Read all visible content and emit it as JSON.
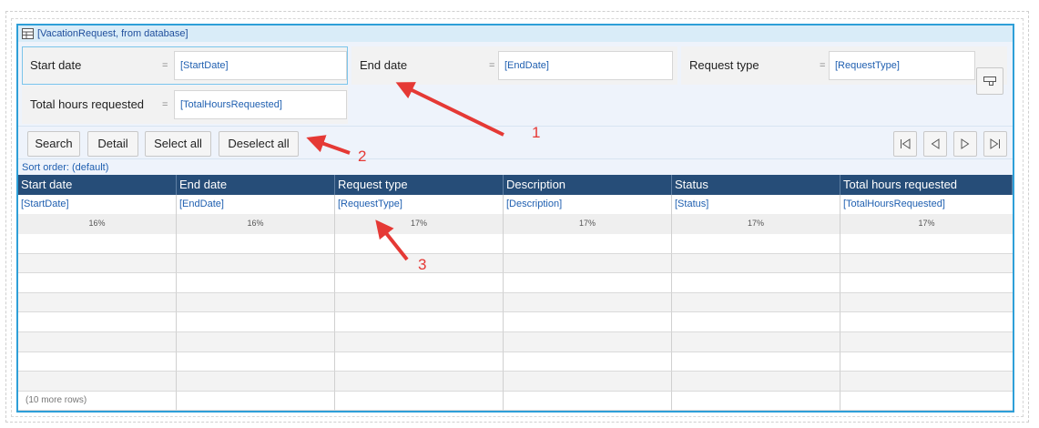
{
  "title_bar": {
    "label": "[VacationRequest, from database]",
    "icon": "database-table-icon"
  },
  "search_fields": [
    {
      "label": "Start date",
      "operator": "=",
      "value": "[StartDate]"
    },
    {
      "label": "End date",
      "operator": "=",
      "value": "[EndDate]"
    },
    {
      "label": "Request type",
      "operator": "=",
      "value": "[RequestType]"
    },
    {
      "label": "Total hours requested",
      "operator": "=",
      "value": "[TotalHoursRequested]"
    }
  ],
  "toolbar": {
    "search": "Search",
    "detail": "Detail",
    "select_all": "Select all",
    "deselect_all": "Deselect all",
    "nav_icons": [
      "first-page-icon",
      "previous-page-icon",
      "next-page-icon",
      "last-page-icon"
    ]
  },
  "sort_order": "Sort order: (default)",
  "grid": {
    "columns": [
      {
        "header": "Start date",
        "binding": "[StartDate]",
        "width": "16%"
      },
      {
        "header": "End date",
        "binding": "[EndDate]",
        "width": "16%"
      },
      {
        "header": "Request type",
        "binding": "[RequestType]",
        "width": "17%"
      },
      {
        "header": "Description",
        "binding": "[Description]",
        "width": "17%"
      },
      {
        "header": "Status",
        "binding": "[Status]",
        "width": "17%"
      },
      {
        "header": "Total hours requested",
        "binding": "[TotalHoursRequested]",
        "width": "17%"
      }
    ],
    "more_rows": "(10 more rows)"
  },
  "annotations": [
    "1",
    "2",
    "3"
  ],
  "colors": {
    "frame_border": "#2e9fd8",
    "header_bg": "#264d78",
    "binding_text": "#1f5fb0",
    "annotation": "#e53935"
  }
}
